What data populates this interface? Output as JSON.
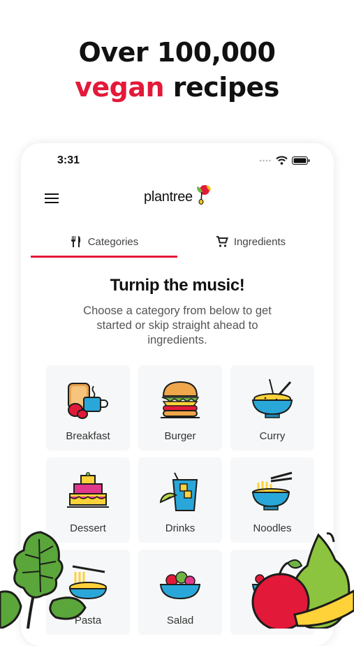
{
  "headline": {
    "line1": "Over 100,000",
    "accent": "vegan",
    "line2_rest": " recipes"
  },
  "status_bar": {
    "time": "3:31"
  },
  "app": {
    "logo_text": "plantree"
  },
  "tabs": [
    {
      "label": "Categories",
      "icon": "fork-knife-icon",
      "active": true
    },
    {
      "label": "Ingredients",
      "icon": "cart-icon",
      "active": false
    }
  ],
  "main": {
    "title": "Turnip the music!",
    "subtitle": "Choose a category from below to get started or skip straight ahead to ingredients."
  },
  "categories": [
    {
      "label": "Breakfast",
      "icon": "breakfast-icon"
    },
    {
      "label": "Burger",
      "icon": "burger-icon"
    },
    {
      "label": "Curry",
      "icon": "curry-icon"
    },
    {
      "label": "Dessert",
      "icon": "cake-icon"
    },
    {
      "label": "Drinks",
      "icon": "drink-icon"
    },
    {
      "label": "Noodles",
      "icon": "noodles-icon"
    },
    {
      "label": "Pasta",
      "icon": "pasta-icon"
    },
    {
      "label": "Salad",
      "icon": "salad-icon"
    },
    {
      "label": "",
      "icon": "fruit-bowl-icon"
    }
  ],
  "colors": {
    "accent": "#e3193a",
    "tile": "#f6f7f8",
    "outline": "#1d1d1b",
    "bowl": "#2aa7d9",
    "yellow": "#ffd23a"
  }
}
